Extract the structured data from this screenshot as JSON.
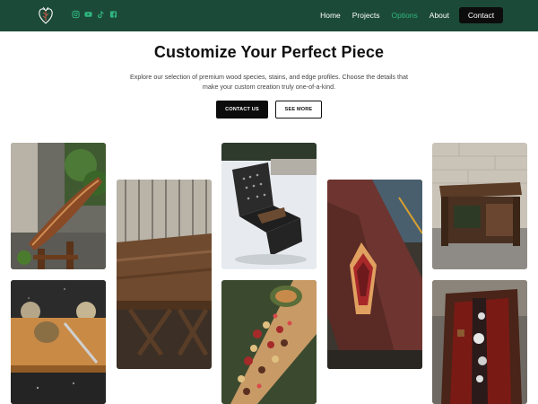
{
  "nav": {
    "logo_icon": "heart-tree-logo",
    "socials": [
      {
        "name": "instagram-icon",
        "color": "#2fb57f"
      },
      {
        "name": "youtube-icon",
        "color": "#2fb57f"
      },
      {
        "name": "tiktok-icon",
        "color": "#2fb57f"
      },
      {
        "name": "facebook-icon",
        "color": "#2fb57f"
      }
    ],
    "links": [
      "Home",
      "Projects",
      "Options",
      "About"
    ],
    "active_link": "Options",
    "contact_label": "Contact"
  },
  "hero": {
    "title": "Customize Your Perfect Piece",
    "description": "Explore our selection of premium wood species, stains, and edge profiles. Choose the details that make your custom creation truly one-of-a-kind.",
    "primary_button": "CONTACT US",
    "secondary_button": "SEE MORE"
  },
  "gallery": {
    "images": [
      {
        "subject": "wooden canoe planter on stand"
      },
      {
        "subject": "cutting board with bread and knife"
      },
      {
        "subject": "walnut farmhouse dining table"
      },
      {
        "subject": "metal fire pit on snow"
      },
      {
        "subject": "charcuterie board spread"
      },
      {
        "subject": "wooden arrow inlay board"
      },
      {
        "subject": "reclaimed wood console cabinet"
      },
      {
        "subject": "epoxy river serving board"
      }
    ]
  },
  "theme": {
    "nav_bg": "#1c4a38",
    "accent": "#2fb57f",
    "button_dark": "#0c0c0c"
  }
}
